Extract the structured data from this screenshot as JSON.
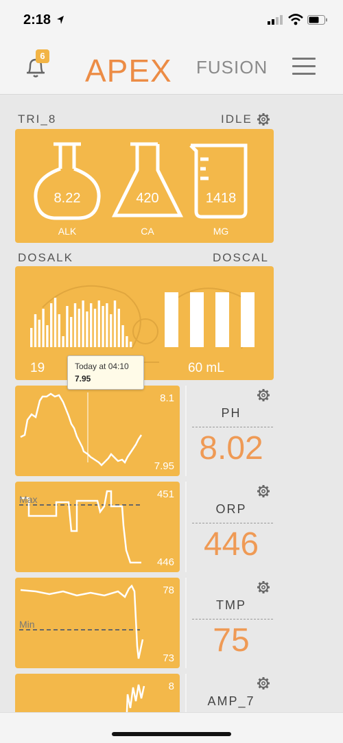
{
  "status_bar": {
    "time": "2:18"
  },
  "header": {
    "notification_count": "6",
    "logo_main": "APEX",
    "logo_sub": "FUSION"
  },
  "trident": {
    "name": "TRI_8",
    "state": "IDLE",
    "readings": [
      {
        "label": "ALK",
        "value": "8.22"
      },
      {
        "label": "CA",
        "value": "420"
      },
      {
        "label": "MG",
        "value": "1418"
      }
    ]
  },
  "dosing": {
    "left_name": "DOSALK",
    "right_name": "DOSCAL",
    "left_value": "19",
    "right_value": "60 mL",
    "left_bars": [
      0.35,
      0.6,
      0.5,
      0.7,
      0.4,
      0.8,
      0.9,
      0.6,
      0.2,
      0.75,
      0.55,
      0.8,
      0.7,
      0.85,
      0.65,
      0.8,
      0.7,
      0.85,
      0.75,
      0.8,
      0.6,
      0.85,
      0.7,
      0.4,
      0.2,
      0.1
    ],
    "right_bars": [
      1,
      1,
      1,
      1
    ]
  },
  "tooltip": {
    "title": "Today at 04:10",
    "value": "7.95"
  },
  "probes": [
    {
      "name": "PH",
      "value": "8.02",
      "graph_max": "8.1",
      "graph_min": "7.95",
      "threshold_label": ""
    },
    {
      "name": "ORP",
      "value": "446",
      "graph_max": "451",
      "graph_min": "446",
      "threshold_label": "Max"
    },
    {
      "name": "TMP",
      "value": "75",
      "graph_max": "78",
      "graph_min": "73",
      "threshold_label": "Min"
    },
    {
      "name": "AMP_7",
      "value": "",
      "graph_max": "8",
      "graph_min": "",
      "threshold_label": ""
    }
  ],
  "colors": {
    "accent": "#f3b84a",
    "value_orange": "#ef9a55",
    "logo_orange": "#ec8c45"
  }
}
